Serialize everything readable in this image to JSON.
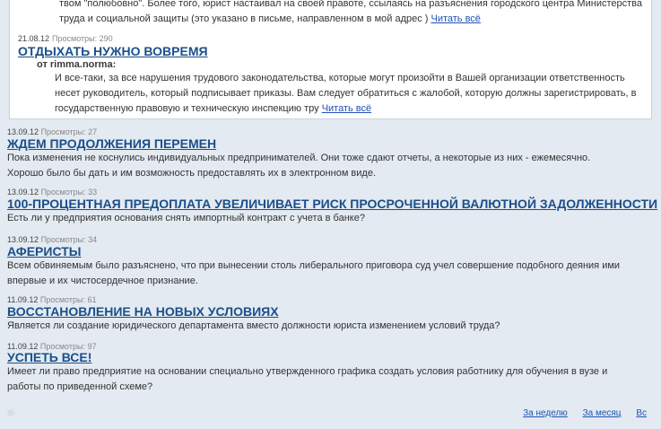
{
  "top_post": {
    "body": "твом \"полюбовно\". Более того, юрист настаивал на своей правоте, ссылаясь на разъяснения городского центра Министерства труда и социальной защиты (это указано в письме, направленном в мой адрес )",
    "read_more": "Читать всё"
  },
  "featured": {
    "date": "21.08.12",
    "views_label": "Просмотры:",
    "views": "290",
    "title": "ОТДЫХАТЬ НУЖНО ВОВРЕМЯ",
    "reply_author": "от rimma.norma:",
    "body": "И все-таки, за все нарушения трудового законодательства, которые могут произойти в Вашей организации ответственность несет руководитель, который подписывает приказы. Вам следует обратиться с  жалобой, которую должны зарегистрировать, в государственную правовую и техническую инспекцию тру",
    "read_more": "Читать всё"
  },
  "items": [
    {
      "date": "13.09.12",
      "views_label": "Просмотры:",
      "views": "27",
      "title": "ЖДЕМ ПРОДОЛЖЕНИЯ ПЕРЕМЕН",
      "body": "Пока изменения не коснулись индивидуальных предпринимателей. Они тоже сдают отчеты, а некоторые из них - ежемесячно. Хорошо было бы дать и им возможность предоставлять их в электронном виде."
    },
    {
      "date": "13.09.12",
      "views_label": "Просмотры:",
      "views": "33",
      "title": "100-ПРОЦЕНТНАЯ ПРЕДОПЛАТА УВЕЛИЧИВАЕТ РИСК ПРОСРОЧЕННОЙ ВАЛЮТНОЙ ЗАДОЛЖЕННОСТИ",
      "body": "Есть ли у предприятия основания снять импортный контракт с учета в банке?"
    },
    {
      "date": "13.09.12",
      "views_label": "Просмотры:",
      "views": "34",
      "title": "АФЕРИСТЫ",
      "body": "Всем обвиняемым было разъяснено, что при вынесении столь либерального приговора суд учел совершение подобного деяния ими впервые и их чистосердечное признание."
    },
    {
      "date": "11.09.12",
      "views_label": "Просмотры:",
      "views": "61",
      "title": "ВОССТАНОВЛЕНИЕ НА НОВЫХ УСЛОВИЯХ",
      "body": "Является ли создание юридического департамента вместо должности юриста изменением условий труда?"
    },
    {
      "date": "11.09.12",
      "views_label": "Просмотры:",
      "views": "97",
      "title": "УСПЕТЬ ВСЕ!",
      "body": "Имеет ли право предприятие на основании специально утвержденного графика создать условия работнику для обучения в вузе и работы по приведенной схеме?"
    }
  ],
  "footer": {
    "week": "За неделю",
    "month": "За месяц",
    "all": "Вс"
  }
}
